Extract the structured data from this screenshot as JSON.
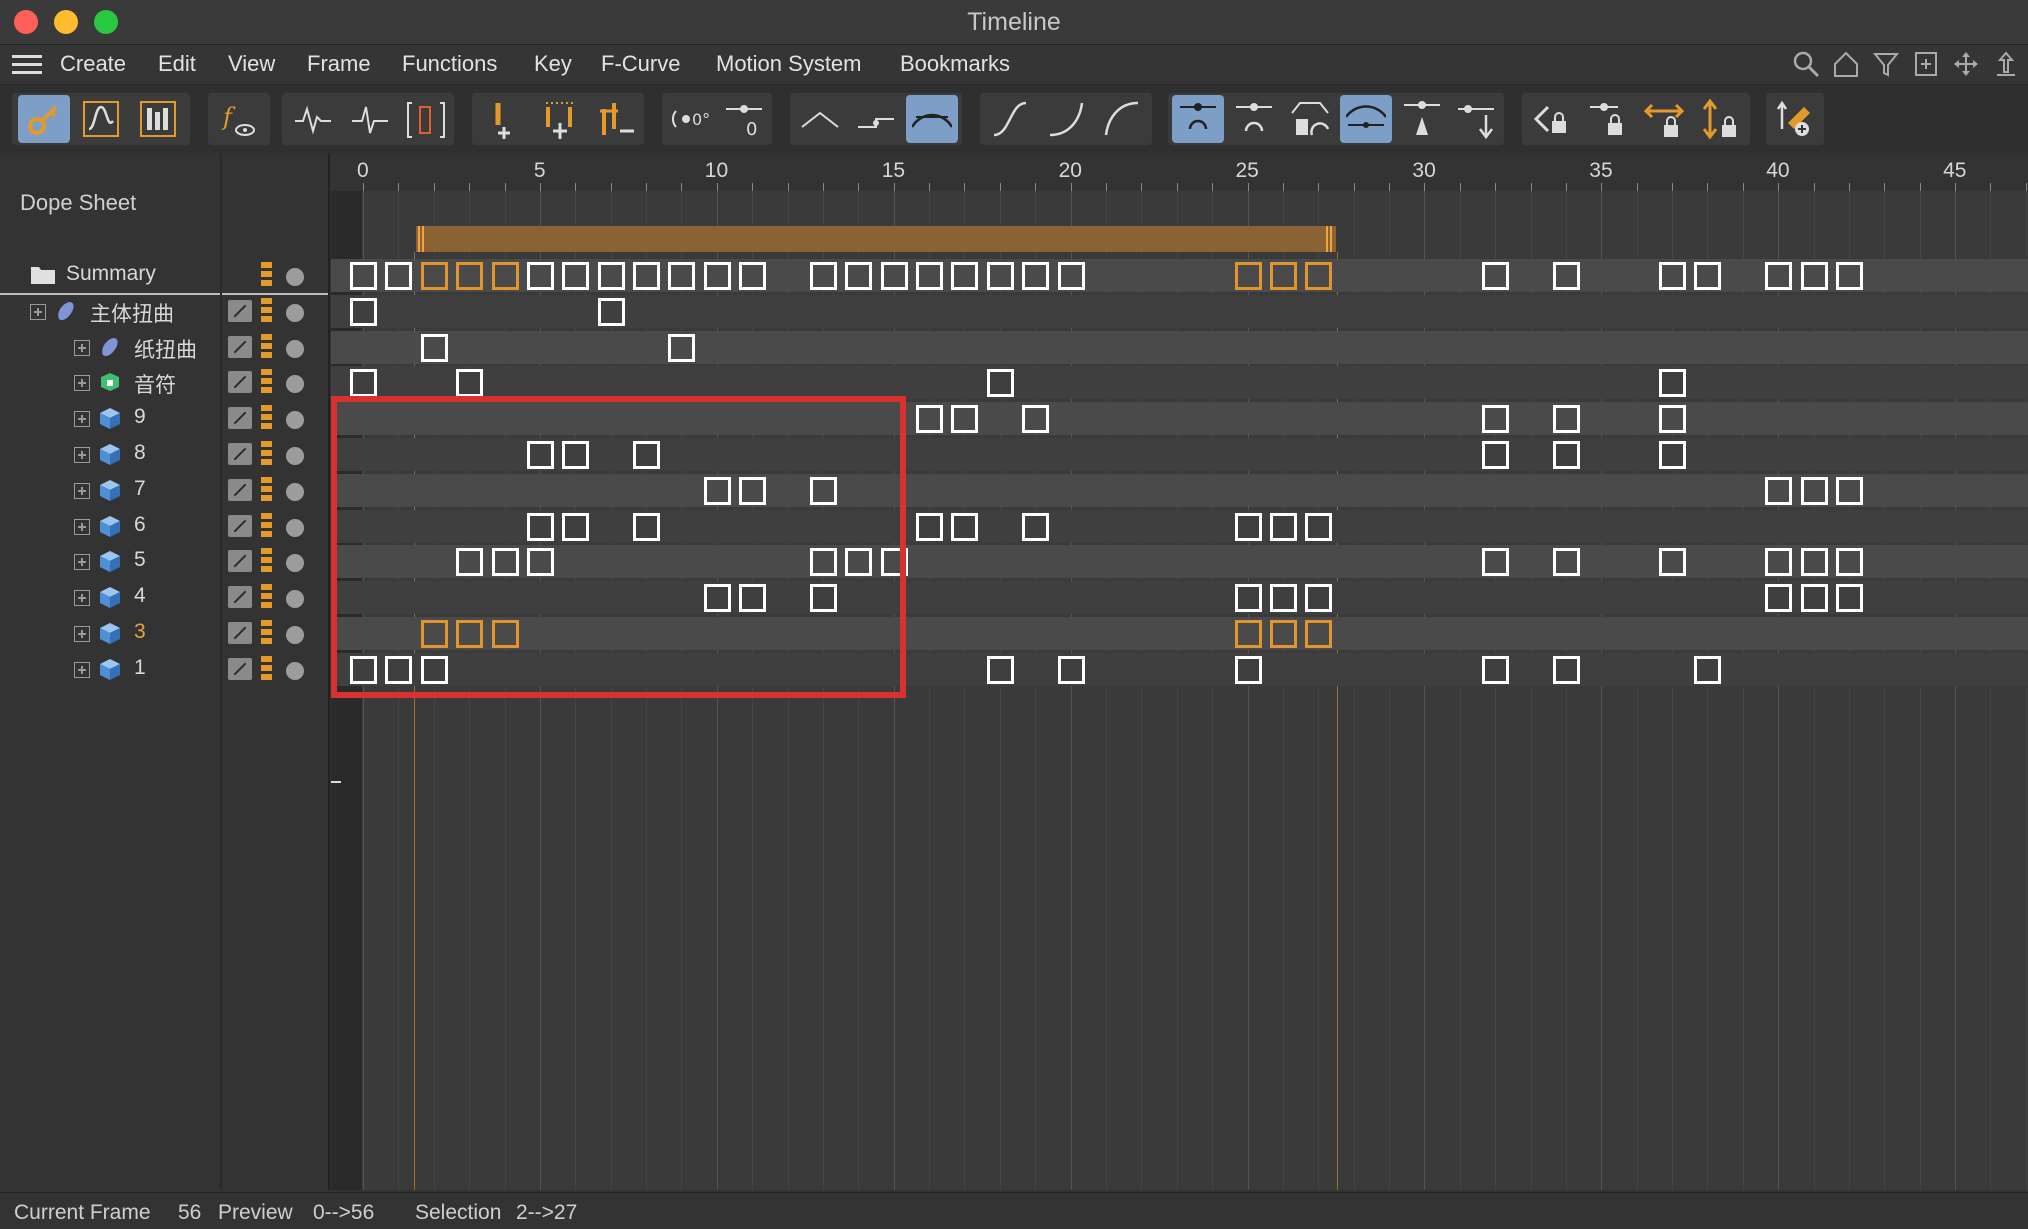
{
  "window": {
    "title": "Timeline"
  },
  "menu": {
    "items": [
      "Create",
      "Edit",
      "View",
      "Frame",
      "Functions",
      "Key",
      "F-Curve",
      "Motion System",
      "Bookmarks"
    ],
    "right_icons": [
      "search-icon",
      "home-icon",
      "filter-icon",
      "new-window-icon",
      "move-icon",
      "pin-icon"
    ]
  },
  "toolbar": {
    "buttons": [
      "key-mode-icon",
      "fcurve-mode-icon",
      "motion-mode-icon",
      "function-view-icon",
      "wave-normal-icon",
      "wave-pulse-icon",
      "wave-bracket-icon",
      "add-key-icon",
      "add-multiple-keys-icon",
      "remove-key-icon",
      "rotate-zero-icon",
      "value-zero-icon",
      "ease-peak-icon",
      "ease-step-icon",
      "ease-smooth-icon",
      "spline-s-icon",
      "spline-ease-in-icon",
      "spline-ease-out-icon",
      "tangent-auto-icon",
      "tangent-break-icon",
      "tangent-weighted-icon",
      "tangent-overshoot-icon",
      "tangent-clamp-icon",
      "tangent-move-icon",
      "lock-time-icon",
      "lock-value-icon",
      "lock-horizontal-icon",
      "lock-vertical-icon",
      "snap-icon"
    ],
    "active": [
      "key-mode-icon",
      "ease-smooth-icon",
      "tangent-auto-icon",
      "tangent-overshoot-icon"
    ]
  },
  "left_panel": {
    "header": "Dope Sheet",
    "tracks": [
      {
        "label": "Summary",
        "icon": "folder-icon",
        "indent": 0,
        "selected": false
      },
      {
        "label": "主体扭曲",
        "icon": "deformer-icon",
        "indent": 1,
        "selected": false
      },
      {
        "label": "纸扭曲",
        "icon": "deformer-icon",
        "indent": 2,
        "selected": false
      },
      {
        "label": "音符",
        "icon": "object-green-icon",
        "indent": 2,
        "selected": false
      },
      {
        "label": "9",
        "icon": "cube-icon",
        "indent": 2,
        "selected": false
      },
      {
        "label": "8",
        "icon": "cube-icon",
        "indent": 2,
        "selected": false
      },
      {
        "label": "7",
        "icon": "cube-icon",
        "indent": 2,
        "selected": false
      },
      {
        "label": "6",
        "icon": "cube-icon",
        "indent": 2,
        "selected": false
      },
      {
        "label": "5",
        "icon": "cube-icon",
        "indent": 2,
        "selected": false
      },
      {
        "label": "4",
        "icon": "cube-icon",
        "indent": 2,
        "selected": false
      },
      {
        "label": "3",
        "icon": "cube-icon",
        "indent": 2,
        "selected": true
      },
      {
        "label": "1",
        "icon": "cube-icon",
        "indent": 2,
        "selected": false
      }
    ]
  },
  "timeline": {
    "ruler_labels": [
      "0",
      "5",
      "10",
      "15",
      "20",
      "25",
      "30",
      "35",
      "40",
      "45"
    ],
    "selection_range": [
      2,
      27
    ],
    "keys": [
      {
        "frames": [
          0,
          1,
          2,
          3,
          4,
          5,
          6,
          7,
          8,
          9,
          10,
          11,
          13,
          14,
          15,
          16,
          17,
          18,
          19,
          20,
          25,
          26,
          27,
          32,
          34,
          37,
          38,
          40,
          41,
          42
        ],
        "selected": [
          2,
          3,
          4,
          25,
          26,
          27
        ]
      },
      {
        "frames": [
          0,
          7
        ],
        "selected": []
      },
      {
        "frames": [
          2,
          9
        ],
        "selected": []
      },
      {
        "frames": [
          0,
          3,
          18,
          37
        ],
        "selected": []
      },
      {
        "frames": [
          16,
          17,
          19,
          32,
          34,
          37
        ],
        "selected": []
      },
      {
        "frames": [
          5,
          6,
          8,
          32,
          34,
          37
        ],
        "selected": []
      },
      {
        "frames": [
          10,
          11,
          13,
          40,
          41,
          42
        ],
        "selected": []
      },
      {
        "frames": [
          5,
          6,
          8,
          16,
          17,
          19,
          25,
          26,
          27
        ],
        "selected": []
      },
      {
        "frames": [
          3,
          4,
          5,
          13,
          14,
          15,
          32,
          34,
          37,
          40,
          41,
          42
        ],
        "selected": []
      },
      {
        "frames": [
          10,
          11,
          13,
          25,
          26,
          27,
          40,
          41,
          42
        ],
        "selected": []
      },
      {
        "frames": [
          2,
          3,
          4,
          25,
          26,
          27
        ],
        "selected": [
          2,
          3,
          4,
          25,
          26,
          27
        ]
      },
      {
        "frames": [
          0,
          1,
          2,
          18,
          20,
          25,
          32,
          34,
          38
        ],
        "selected": []
      }
    ]
  },
  "status": {
    "current_frame_label": "Current Frame",
    "current_frame_value": "56",
    "preview_label": "Preview",
    "preview_value": "0-->56",
    "selection_label": "Selection",
    "selection_value": "2-->27"
  },
  "colors": {
    "accent_orange": "#e0952f",
    "selection_band": "#8a6233",
    "highlight_red": "#d93030",
    "active_button": "#7d9ec7"
  }
}
